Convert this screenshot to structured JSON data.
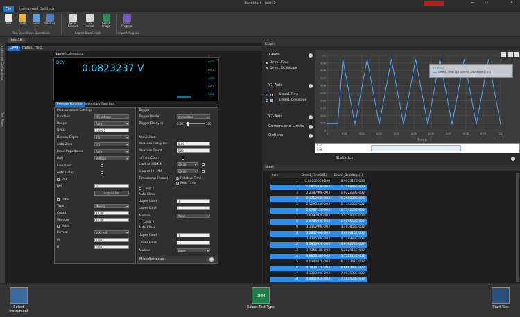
{
  "window": {
    "title": "BackStart - test10"
  },
  "menu": {
    "tabs": [
      "File",
      "Instrument",
      "Settings"
    ]
  },
  "ribbon": {
    "buttons": [
      {
        "label": "New",
        "icon": "new-file-icon"
      },
      {
        "label": "Open",
        "icon": "open-folder-icon"
      },
      {
        "label": "Save",
        "icon": "save-icon"
      },
      {
        "label": "Save As",
        "icon": "save-as-icon"
      },
      {
        "label": "Excel Format",
        "icon": "excel-icon"
      },
      {
        "label": "CSV Format",
        "icon": "csv-icon"
      },
      {
        "label": "Graph Image",
        "icon": "graph-image-icon"
      },
      {
        "label": "Load Plug-ins",
        "icon": "plugin-icon"
      }
    ],
    "groups": [
      "Test Open/Save Operations",
      "Export Data/Graph",
      "Import Plug-ins"
    ]
  },
  "document_tab": "test10",
  "side_tabs": [
    "Instrument Configuration",
    "Test Types"
  ],
  "sub_menu": [
    "DMM",
    "Notes",
    "Help"
  ],
  "readout": {
    "label": "Numerical reading",
    "mode": "DCV",
    "value": "0.0823237 V",
    "right_labels": [
      "Auto",
      "Auto",
      "Auto",
      "Auto",
      "Auto"
    ]
  },
  "function_tabs": [
    "Primary Function",
    "Secondary Function"
  ],
  "measurement": {
    "title": "Measurement Settings",
    "rows": [
      {
        "label": "Function",
        "value": "DC Voltage"
      },
      {
        "label": "Range",
        "value": "Auto"
      },
      {
        "label": "NPLC",
        "value": "0.0005"
      },
      {
        "label": "Display Digits",
        "value": "7.5"
      },
      {
        "label": "Auto Zero",
        "value": "Off"
      },
      {
        "label": "Input Impedance",
        "value": "Auto"
      },
      {
        "label": "Unit",
        "value": "Voltage"
      }
    ],
    "line_sync": "Line Sync",
    "auto_delay": "Auto Delay",
    "rel": "Rel",
    "rel_label": "Rel",
    "rel_value": "0",
    "acquire_rel": "Acquire Rel",
    "filter": "Filter",
    "filter_rows": [
      {
        "label": "Type",
        "value": "Moving"
      },
      {
        "label": "Count",
        "value": "10.00"
      },
      {
        "label": "Window",
        "value": "10.00"
      }
    ],
    "math": "Math",
    "math_rows": [
      {
        "label": "Format",
        "value": "b(X) + B"
      },
      {
        "label": "M",
        "value": "1.00"
      },
      {
        "label": "B",
        "value": "0.00"
      }
    ]
  },
  "trigger": {
    "title": "Trigger",
    "rows": [
      {
        "label": "Trigger Mode",
        "value": "Immediate"
      },
      {
        "label": "Trigger Delay (s)",
        "value": "0.001"
      }
    ],
    "slider_max": "100",
    "acquisition_title": "Acquisition",
    "acq_rows": [
      {
        "label": "Measure Delay (s)",
        "value": "0.00"
      },
      {
        "label": "Measure Count",
        "value": "500"
      }
    ],
    "infinite": "Infinite Count",
    "start_label": "Start at HH:MM",
    "start_value": "00:00",
    "stop_label": "Stop at HH:MM",
    "stop_value": "00:00",
    "ts_label": "Timestamp Format",
    "ts_options": [
      "Relative Time",
      "Real Time"
    ],
    "limit1": "Limit 1",
    "limit2": "Limit 2",
    "auto_clear": "Auto Clear",
    "limit1_rows": [
      {
        "label": "Upper Limit",
        "value": "1"
      },
      {
        "label": "Lower Limit",
        "value": "-1"
      },
      {
        "label": "Audible",
        "value": "None"
      }
    ],
    "limit2_rows": [
      {
        "label": "Upper Limit",
        "value": "1"
      },
      {
        "label": "Lower Limit",
        "value": "-1"
      },
      {
        "label": "Audible",
        "value": "None"
      }
    ],
    "misc": "Miscellaneous"
  },
  "graph": {
    "tab": "Graph",
    "xaxis_title": "X-Axis",
    "x_options": [
      "Dmm1.Time",
      "Dmm1.DcVoltage"
    ],
    "y1_title": "Y1-Axis",
    "y1_items": [
      "Dmm1.Time",
      "Dmm1.DcVoltage"
    ],
    "y2_title": "Y2-Axis",
    "cursors": "Cursors and Limits",
    "options": "Options",
    "statistics": "Statistics",
    "legend_title": "Legend",
    "legend_item": "Dmm1_Time(1)(1)(Dmm1_DcVoltage)(1)(1)",
    "xaxis_label": "Time (s)",
    "slider_value": "0.03",
    "slider_value2": "0.06"
  },
  "chart_data": {
    "type": "line",
    "xlabel": "Time (s)",
    "ylabel": "",
    "xticks": [
      "0",
      "0.01",
      "0.02",
      "0.03",
      "0.04",
      "0.05",
      "0.06",
      "0.07",
      "0.08",
      "0.09",
      "0.1"
    ],
    "yticks": [
      "0.1",
      "0.09",
      "0.08",
      "0.07",
      "0.06",
      "0.05",
      "0.04",
      "0.03",
      "0.02",
      "0.01",
      "0"
    ],
    "ylim": [
      0,
      0.1
    ],
    "xlim": [
      0,
      0.1
    ],
    "x": [
      0,
      0.006,
      0.009,
      0.016,
      0.023,
      0.03,
      0.037,
      0.044,
      0.051,
      0.058,
      0.065,
      0.072,
      0.079,
      0.086,
      0.093,
      0.1
    ],
    "y": [
      0.009,
      0.009,
      0.095,
      0.008,
      0.095,
      0.008,
      0.095,
      0.008,
      0.095,
      0.008,
      0.095,
      0.008,
      0.095,
      0.008,
      0.095,
      0.008
    ],
    "series": [
      {
        "name": "Dmm1_Time(1)(1)(Dmm1_DcVoltage)(1)(1)",
        "color": "#4da3ff"
      }
    ],
    "grid": true,
    "legend": "top-right"
  },
  "sheet": {
    "tab": "Sheet",
    "headers": [
      "Item",
      "Dmm1_Time(1)(1)",
      "Dmm1_DcVoltage(1)"
    ],
    "rows": [
      [
        "1",
        "0.000000E+000",
        "8.903317E-003"
      ],
      [
        "2",
        "1.095593E-003",
        "7.356896E-003"
      ],
      [
        "3",
        "2.218790E-003",
        "1.022229E-002"
      ],
      [
        "4",
        "2.371293E-003",
        "1.260039E-002"
      ],
      [
        "5",
        "2.529533E-003",
        "1.730230E-002"
      ],
      [
        "6",
        "2.679712E-003",
        "2.114225E-002"
      ],
      [
        "7",
        "2.829293E-003",
        "2.525433E-002"
      ],
      [
        "8",
        "2.978503E-003",
        "2.929559E-002"
      ],
      [
        "9",
        "3.131290E-003",
        "3.407853E-002"
      ],
      [
        "10",
        "3.283709E-003",
        "3.869015E-002"
      ],
      [
        "11",
        "3.434539E-003",
        "4.329989E-002"
      ],
      [
        "12",
        "3.585093E-003",
        "4.816272E-002"
      ],
      [
        "13",
        "3.735618E-003",
        "5.282915E-002"
      ],
      [
        "14",
        "3.885328E-003",
        "5.752114E-002"
      ],
      [
        "15",
        "4.034087E-003",
        "6.211341E-002"
      ],
      [
        "16",
        "4.183477E-003",
        "6.666349E-002"
      ],
      [
        "17",
        "4.330389E-003",
        "7.097503E-002"
      ],
      [
        "18",
        "4.480194E-003",
        "7.504428E-002"
      ]
    ]
  },
  "bottom": {
    "select_instrument": "Select Instrument",
    "select_test_type": "Select Test Type",
    "test_type_badge": "DMM",
    "start_test": "Start Test"
  },
  "colors": {
    "accent": "#1f6fc4",
    "series": "#4da3ff",
    "highlight_row": "#2f8ee8",
    "readout": "#1dd2ff"
  }
}
